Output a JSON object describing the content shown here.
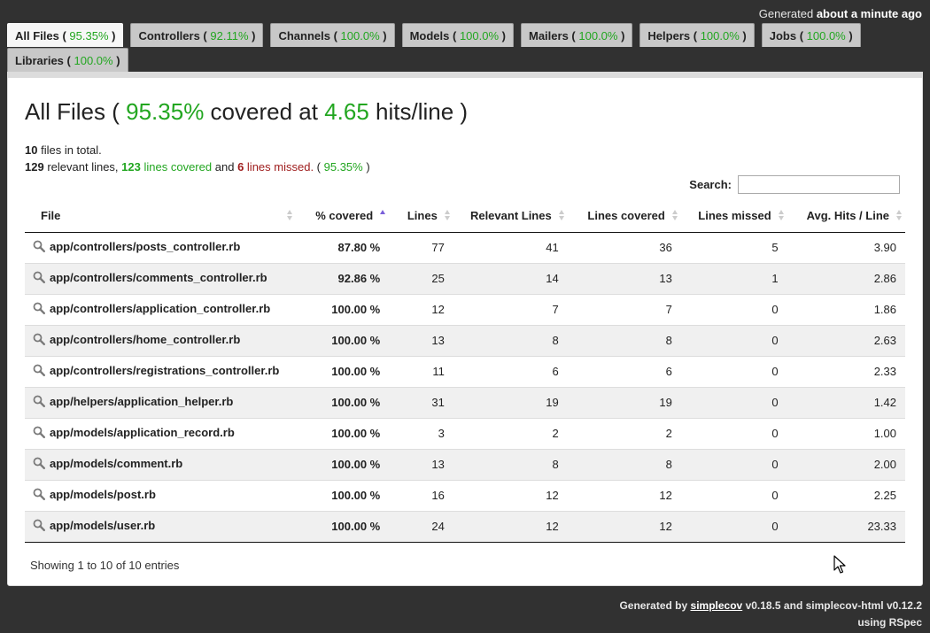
{
  "timestamp": {
    "prefix": "Generated",
    "value": "about a minute ago"
  },
  "tabs": [
    {
      "label": "All Files",
      "pct": "95.35%"
    },
    {
      "label": "Controllers",
      "pct": "92.11%"
    },
    {
      "label": "Channels",
      "pct": "100.0%"
    },
    {
      "label": "Models",
      "pct": "100.0%"
    },
    {
      "label": "Mailers",
      "pct": "100.0%"
    },
    {
      "label": "Helpers",
      "pct": "100.0%"
    },
    {
      "label": "Jobs",
      "pct": "100.0%"
    },
    {
      "label": "Libraries",
      "pct": "100.0%"
    }
  ],
  "heading": {
    "name": "All Files",
    "pct": "95.35%",
    "mid": "covered at",
    "hits": "4.65",
    "unit": "hits/line"
  },
  "summary": {
    "files_count": "10",
    "files_text": "files in total.",
    "relevant": "129",
    "relevant_text": "relevant lines,",
    "covered": "123",
    "covered_text": "lines covered",
    "and_text": "and",
    "missed": "6",
    "missed_text": "lines missed.",
    "pct": "95.35%"
  },
  "search": {
    "label": "Search:",
    "value": ""
  },
  "table": {
    "headers": [
      "File",
      "% covered",
      "Lines",
      "Relevant Lines",
      "Lines covered",
      "Lines missed",
      "Avg. Hits / Line"
    ],
    "rows": [
      {
        "file": "app/controllers/posts_controller.rb",
        "covered": "87.80 %",
        "lines": "77",
        "relevant": "41",
        "lines_covered": "36",
        "missed": "5",
        "avg": "3.90"
      },
      {
        "file": "app/controllers/comments_controller.rb",
        "covered": "92.86 %",
        "lines": "25",
        "relevant": "14",
        "lines_covered": "13",
        "missed": "1",
        "avg": "2.86"
      },
      {
        "file": "app/controllers/application_controller.rb",
        "covered": "100.00 %",
        "lines": "12",
        "relevant": "7",
        "lines_covered": "7",
        "missed": "0",
        "avg": "1.86"
      },
      {
        "file": "app/controllers/home_controller.rb",
        "covered": "100.00 %",
        "lines": "13",
        "relevant": "8",
        "lines_covered": "8",
        "missed": "0",
        "avg": "2.63"
      },
      {
        "file": "app/controllers/registrations_controller.rb",
        "covered": "100.00 %",
        "lines": "11",
        "relevant": "6",
        "lines_covered": "6",
        "missed": "0",
        "avg": "2.33"
      },
      {
        "file": "app/helpers/application_helper.rb",
        "covered": "100.00 %",
        "lines": "31",
        "relevant": "19",
        "lines_covered": "19",
        "missed": "0",
        "avg": "1.42"
      },
      {
        "file": "app/models/application_record.rb",
        "covered": "100.00 %",
        "lines": "3",
        "relevant": "2",
        "lines_covered": "2",
        "missed": "0",
        "avg": "1.00"
      },
      {
        "file": "app/models/comment.rb",
        "covered": "100.00 %",
        "lines": "13",
        "relevant": "8",
        "lines_covered": "8",
        "missed": "0",
        "avg": "2.00"
      },
      {
        "file": "app/models/post.rb",
        "covered": "100.00 %",
        "lines": "16",
        "relevant": "12",
        "lines_covered": "12",
        "missed": "0",
        "avg": "2.25"
      },
      {
        "file": "app/models/user.rb",
        "covered": "100.00 %",
        "lines": "24",
        "relevant": "12",
        "lines_covered": "12",
        "missed": "0",
        "avg": "23.33"
      }
    ]
  },
  "info": "Showing 1 to 10 of 10 entries",
  "footer": {
    "gen_by": "Generated by",
    "link": "simplecov",
    "rest": "v0.18.5 and simplecov-html v0.12.2",
    "line2": "using RSpec"
  },
  "colors": {
    "green": "#22a620",
    "yellow": "#d8b818",
    "red": "#9e1b1b",
    "background": "#313131"
  }
}
